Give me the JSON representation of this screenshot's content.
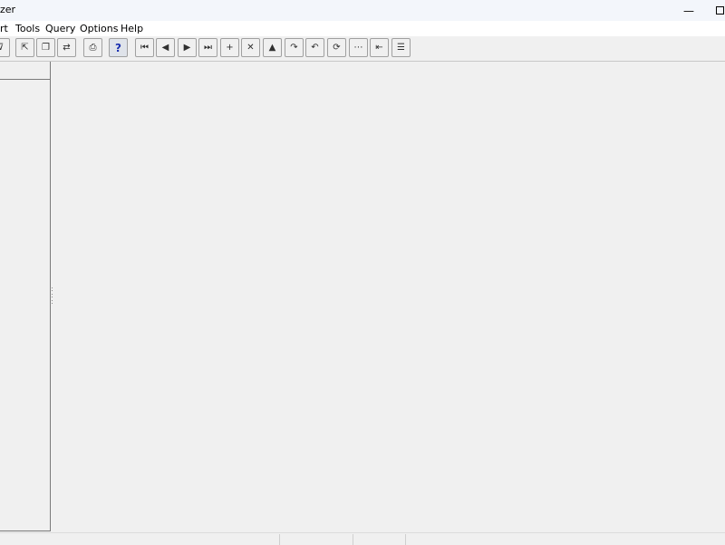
{
  "window": {
    "title": "zer",
    "minimize_glyph": "—"
  },
  "menu": {
    "items": [
      {
        "label": "rt"
      },
      {
        "label": "Tools"
      },
      {
        "label": "Query"
      },
      {
        "label": "Options"
      },
      {
        "label": "Help"
      }
    ]
  },
  "toolbar": {
    "buttons": [
      {
        "name": "filter-icon",
        "glyph": "⊽"
      },
      {
        "name": "export-icon",
        "glyph": "⇱"
      },
      {
        "name": "copy-icon",
        "glyph": "❐"
      },
      {
        "name": "transfer-icon",
        "glyph": "⇄"
      },
      {
        "name": "print-icon",
        "glyph": "⎙"
      },
      {
        "name": "help-icon",
        "glyph": "?"
      },
      {
        "name": "first-record-icon",
        "glyph": "⏮"
      },
      {
        "name": "previous-record-icon",
        "glyph": "◀"
      },
      {
        "name": "next-record-icon",
        "glyph": "▶"
      },
      {
        "name": "last-record-icon",
        "glyph": "⏭"
      },
      {
        "name": "add-record-icon",
        "glyph": "+"
      },
      {
        "name": "delete-record-icon",
        "glyph": "✕"
      },
      {
        "name": "up-icon",
        "glyph": "▲"
      },
      {
        "name": "redo-icon",
        "glyph": "↷"
      },
      {
        "name": "undo-icon",
        "glyph": "↶"
      },
      {
        "name": "refresh-icon",
        "glyph": "⟳"
      },
      {
        "name": "columns-icon",
        "glyph": "⋯"
      },
      {
        "name": "indent-left-icon",
        "glyph": "⇤"
      },
      {
        "name": "sort-icon",
        "glyph": "☰"
      }
    ]
  }
}
